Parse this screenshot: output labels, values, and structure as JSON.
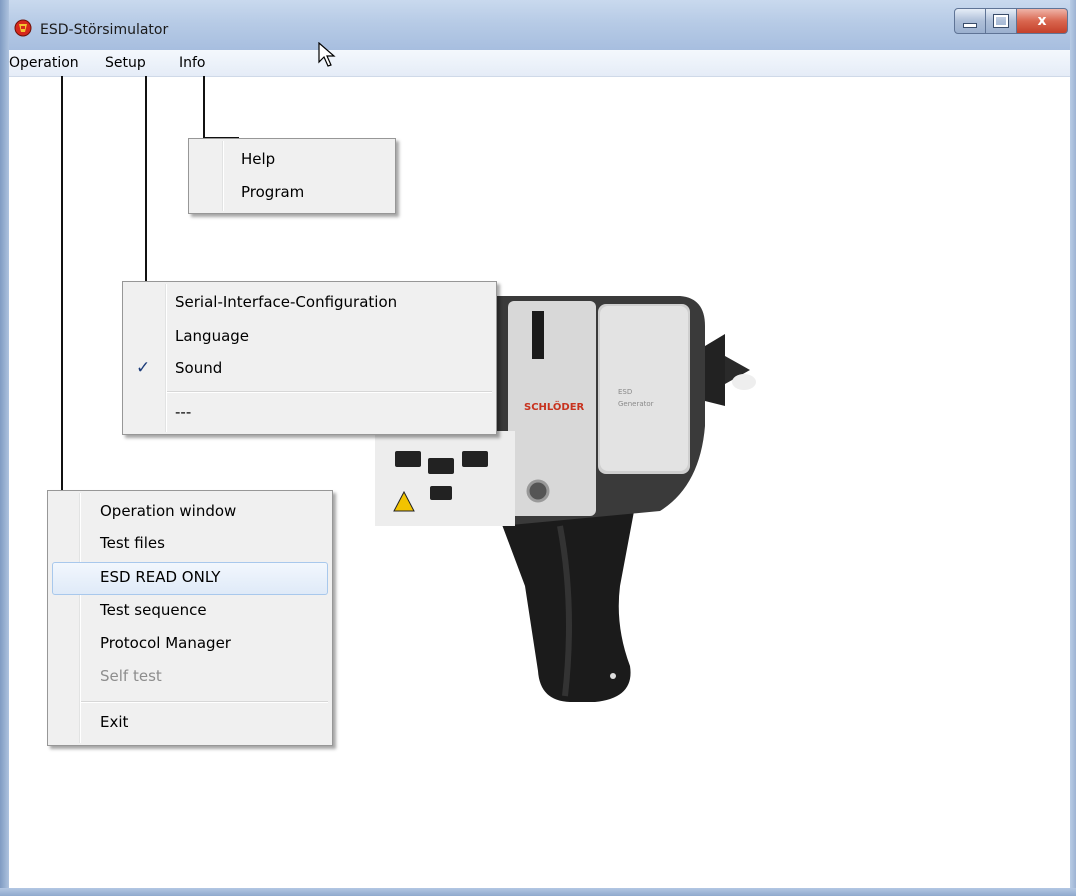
{
  "window": {
    "title": "ESD-Störsimulator",
    "icon": "app-icon",
    "buttons": [
      "minimize-icon",
      "maximize-icon",
      "close-icon"
    ],
    "close_glyph": "x"
  },
  "menubar": {
    "items": [
      "Operation",
      "Setup",
      "Info"
    ]
  },
  "info_menu": {
    "items": [
      "Help",
      "Program"
    ]
  },
  "setup_menu": {
    "items": [
      "Serial-Interface-Configuration",
      "Language",
      "Sound",
      "---"
    ],
    "checked": "Sound",
    "check_glyph": "✓"
  },
  "operation_menu": {
    "items": [
      "Operation window",
      "Test files",
      "ESD READ ONLY",
      "Test sequence",
      "Protocol Manager",
      "Self test",
      "Exit"
    ],
    "highlighted": "ESD READ ONLY",
    "disabled": "Self test"
  },
  "device": {
    "brand": "SCHLÖDER",
    "label_line1": "ESD",
    "label_line2": "Generator"
  },
  "colors": {
    "accent_blue": "#a8c8ec",
    "close_red": "#c4402a",
    "menu_bg": "#f0f0f0"
  }
}
